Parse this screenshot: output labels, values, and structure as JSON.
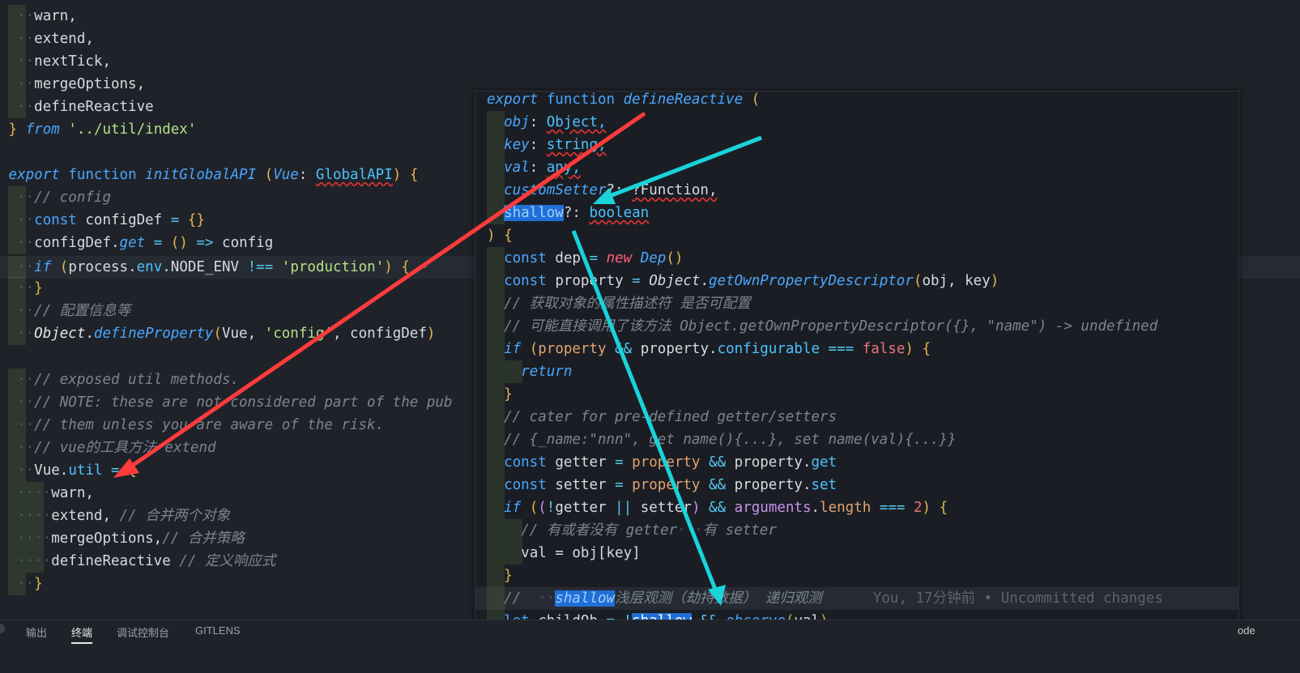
{
  "editor": {
    "import_block": {
      "lines": [
        "warn,",
        "extend,",
        "nextTick,",
        "mergeOptions,",
        "defineReactive"
      ],
      "from_kw": "from",
      "path": "'../util/index'",
      "close": "}"
    },
    "init": {
      "export_kw": "export",
      "function_kw": "function",
      "fn_name": "initGlobalAPI",
      "param": "Vue",
      "param_type": "GlobalAPI",
      "comment_config": "// config",
      "const_kw": "const",
      "config_def": "configDef",
      "get_prop": "get",
      "config_word": "config",
      "if_kw": "if",
      "process": "process",
      "env": "env",
      "node_env": "NODE_ENV",
      "production": "'production'",
      "ellipsis": "⋯",
      "comment_cn1": "// 配置信息等",
      "object": "Object",
      "define_property": "defineProperty",
      "vue": "Vue",
      "config_str": "'config'",
      "comment_exposed": "// exposed util methods.",
      "comment_note": "// NOTE: these are not considered part of the pub",
      "comment_them": "// them unless you are aware of the risk.",
      "comment_vue_util": "// vue的工具方法 extend",
      "util": "util",
      "util_items": [
        "warn,",
        "extend,",
        "mergeOptions,",
        "defineReactive"
      ],
      "util_comments": [
        "",
        "// 合并两个对象",
        "// 合并策略",
        "// 定义响应式"
      ]
    }
  },
  "peek": {
    "fn_name": "defineReactive",
    "params": [
      {
        "name": "obj",
        "type": "Object,"
      },
      {
        "name": "key",
        "type": "string,"
      },
      {
        "name": "val",
        "type": "any,"
      },
      {
        "name": "customSetter",
        "type": "?Function,"
      },
      {
        "name": "shallow",
        "type": "boolean"
      }
    ],
    "dep": "dep",
    "new_kw": "new",
    "dep_class": "Dep",
    "property": "property",
    "gopd": "getOwnPropertyDescriptor",
    "obj_key": "obj, key",
    "cm_get_desc": "// 获取对象的属性描述符 是否可配置",
    "cm_maybe": "// 可能直接调用了该方法 Object.getOwnPropertyDescriptor({}, \"name\") -> undefined",
    "configurable": "configurable",
    "false_kw": "false",
    "return_kw": "return",
    "cm_cater": "// cater for pre-defined getter/setters",
    "cm_example": "// {_name:\"nnn\", get name(){...}, set name(val){...}}",
    "getter": "getter",
    "setter": "setter",
    "get": "get",
    "set": "set",
    "arguments": "arguments",
    "length": "length",
    "two": "2",
    "cm_has_getter": "// 有或者没有 getter",
    "cm_has_setter": "有 setter",
    "val_assign": "val = obj[key]",
    "shallow_word": "shallow",
    "cm_shallow_rest": "浅层观测（劫持数据） 递归观测",
    "blame": "You, 17分钟前 • Uncommitted changes",
    "let_kw": "let",
    "child_ob": "childOb",
    "observe": "observe",
    "val": "val"
  },
  "panel": {
    "tabs": [
      "输出",
      "终端",
      "调试控制台",
      "GITLENS"
    ],
    "active_tab": "终端",
    "node_label": "ode"
  },
  "colors": {
    "background": "#1f2329",
    "keyword": "#4aa6ff",
    "string": "#b5e08a",
    "comment": "#7b8491",
    "selection": "#1f6fd6",
    "red_arrow": "#ff3b3b",
    "cyan_arrow": "#19d3da"
  }
}
